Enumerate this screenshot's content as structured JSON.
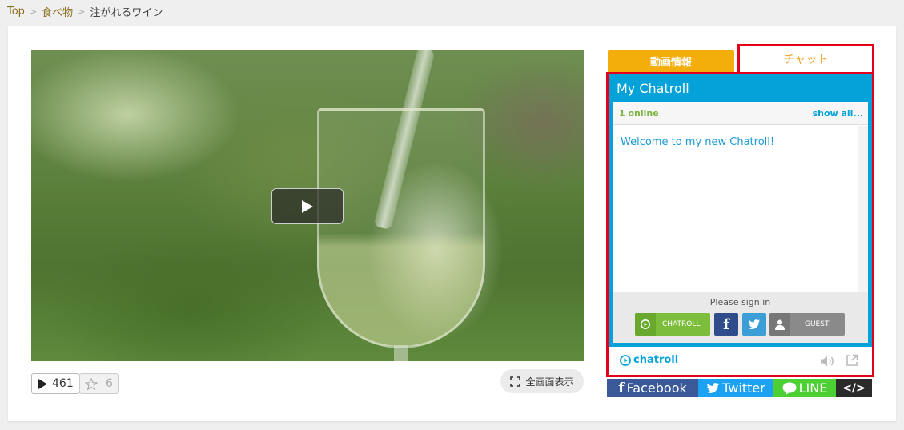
{
  "breadcrumb": {
    "home": "Top",
    "category": "食べ物",
    "current": "注がれるワイン",
    "sep": ">"
  },
  "video": {
    "play_label": "Play"
  },
  "stats": {
    "views": "461",
    "favorites": "6"
  },
  "fullscreen_label": "全画面表示",
  "tabs": {
    "info": "動画情報",
    "chat": "チャット"
  },
  "chat": {
    "title": "My Chatroll",
    "online": "1 online",
    "show_all": "show all...",
    "welcome": "Welcome to my new Chatroll!",
    "signin_title": "Please sign in",
    "chatroll_btn": "CHATROLL",
    "guest_btn": "GUEST",
    "brand": "chatroll"
  },
  "share": {
    "facebook": "Facebook",
    "twitter": "Twitter",
    "line": "LINE",
    "embed": "</>"
  },
  "colors": {
    "chat_accent": "#05a2d9",
    "tab_info": "#f4ae0b",
    "highlight_red": "#e2001a"
  }
}
